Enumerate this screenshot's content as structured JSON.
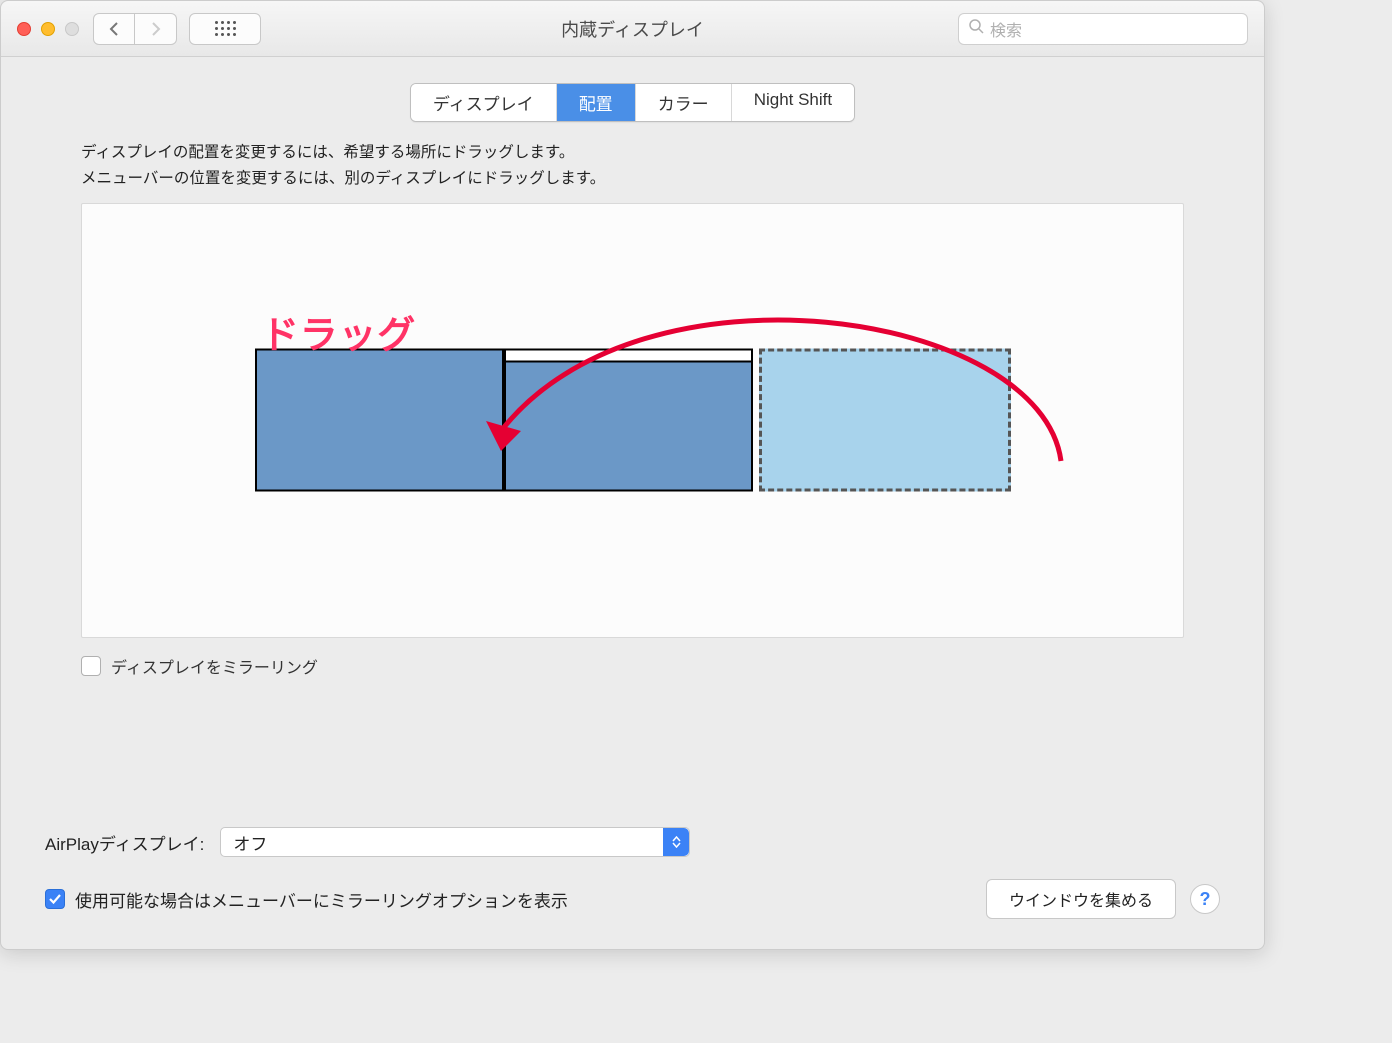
{
  "window": {
    "title": "内蔵ディスプレイ"
  },
  "toolbar": {
    "search_placeholder": "検索"
  },
  "tabs": [
    {
      "label": "ディスプレイ"
    },
    {
      "label": "配置"
    },
    {
      "label": "カラー"
    },
    {
      "label": "Night Shift"
    }
  ],
  "instructions": {
    "line1": "ディスプレイの配置を変更するには、希望する場所にドラッグします。",
    "line2": "メニューバーの位置を変更するには、別のディスプレイにドラッグします。"
  },
  "annotation": {
    "label": "ドラッグ"
  },
  "mirror_checkbox": {
    "label": "ディスプレイをミラーリング"
  },
  "airplay": {
    "label": "AirPlayディスプレイ:",
    "value": "オフ"
  },
  "show_mirror_option": {
    "label": "使用可能な場合はメニューバーにミラーリングオプションを表示"
  },
  "gather": {
    "label": "ウインドウを集める"
  },
  "help": {
    "label": "?"
  }
}
